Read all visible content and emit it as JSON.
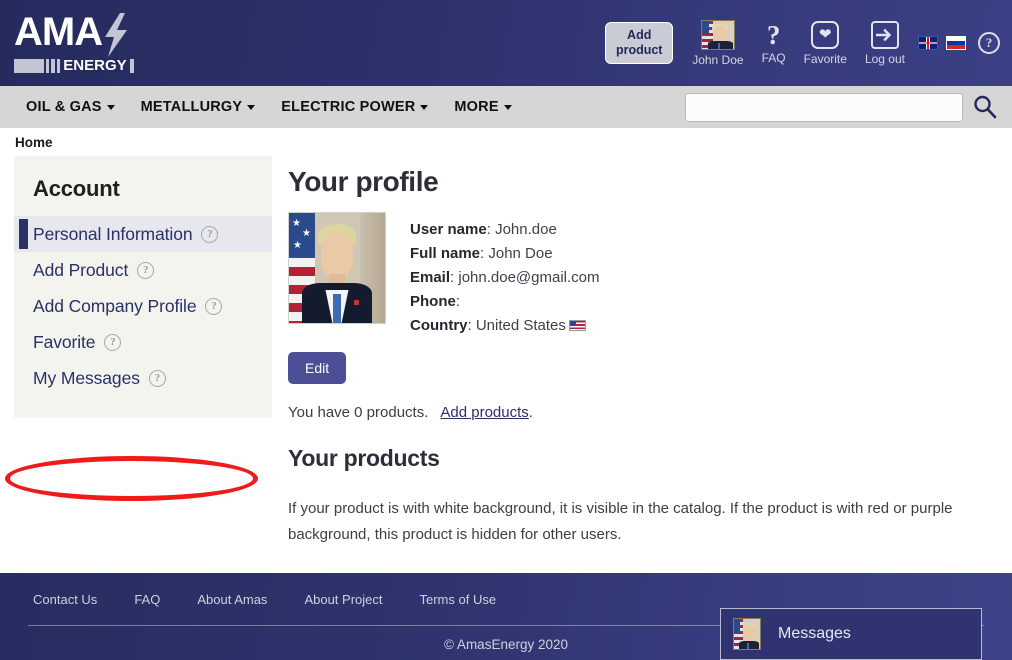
{
  "header": {
    "logo": {
      "word": "AMA",
      "sub": "ENERGY",
      "bolt_icon": "lightning-bolt-icon"
    },
    "add_product_line1": "Add",
    "add_product_line2": "product",
    "user_name": "John Doe",
    "faq_label": "FAQ",
    "favorite_label": "Favorite",
    "logout_label": "Log out",
    "lang_en": "en-flag-icon",
    "lang_ru": "ru-flag-icon",
    "help_icon": "question-mark-circle-icon"
  },
  "nav": {
    "items": [
      {
        "label": "OIL & GAS"
      },
      {
        "label": "METALLURGY"
      },
      {
        "label": "ELECTRIC POWER"
      },
      {
        "label": "MORE"
      }
    ],
    "search_value": "",
    "search_placeholder": ""
  },
  "breadcrumb": {
    "home": "Home"
  },
  "sidebar": {
    "title": "Account",
    "items": [
      {
        "label": "Personal Information",
        "active": true
      },
      {
        "label": "Add Product",
        "active": false
      },
      {
        "label": "Add Company Profile",
        "active": false
      },
      {
        "label": "Favorite",
        "active": false
      },
      {
        "label": "My Messages",
        "active": false
      }
    ],
    "help_glyph": "?"
  },
  "annotation": {
    "shape": "red-ellipse",
    "color": "#ef1b1b",
    "targets": "Add Company Profile"
  },
  "main": {
    "title": "Your profile",
    "fields": [
      {
        "label": "User name",
        "value": "John.doe"
      },
      {
        "label": "Full name",
        "value": "John Doe"
      },
      {
        "label": "Email",
        "value": "john.doe@gmail.com"
      },
      {
        "label": "Phone",
        "value": ""
      },
      {
        "label": "Country",
        "value": "United States"
      }
    ],
    "edit_label": "Edit",
    "products_count_text": "You have 0 products.",
    "add_products_link": "Add products",
    "add_products_period": ".",
    "products_title": "Your products",
    "products_note": "If your product is with white background, it is visible in the catalog. If the product is with red or purple background, this product is hidden for other users."
  },
  "footer": {
    "links": [
      {
        "label": "Contact Us"
      },
      {
        "label": "FAQ"
      },
      {
        "label": "About Amas"
      },
      {
        "label": "About Project"
      },
      {
        "label": "Terms of Use"
      }
    ],
    "copyright": "© AmasEnergy 2020"
  },
  "messages_widget": {
    "label": "Messages"
  }
}
